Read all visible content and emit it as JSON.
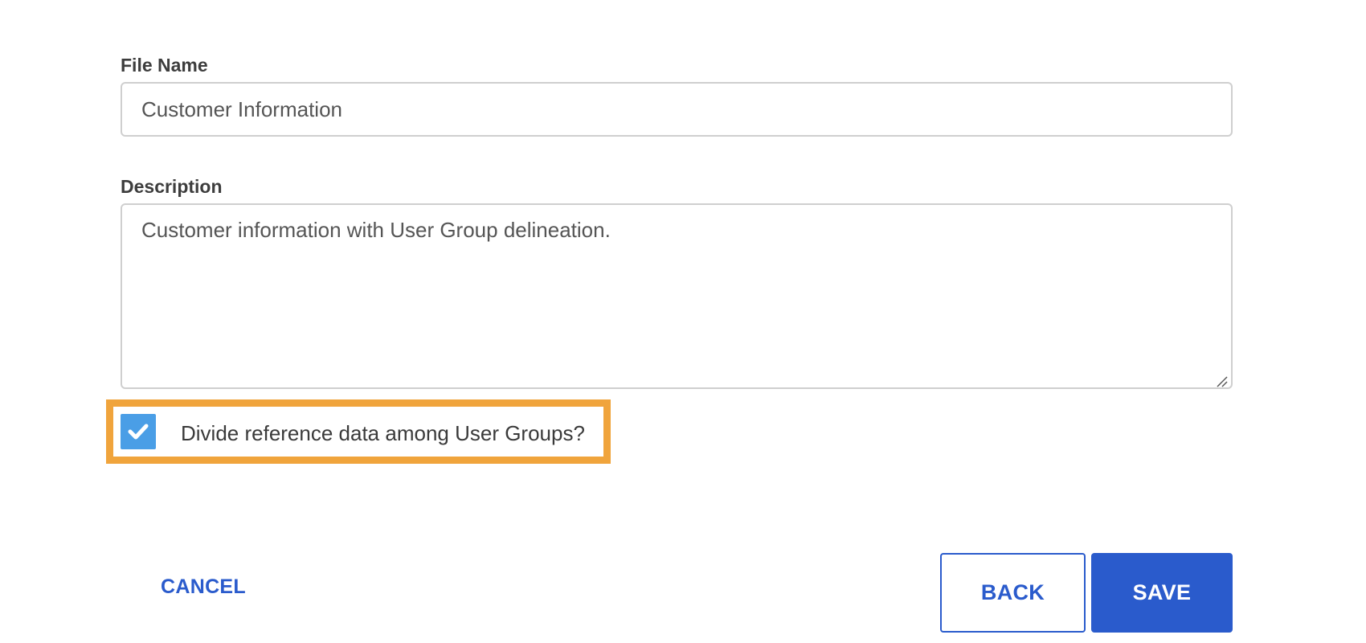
{
  "form": {
    "file_name": {
      "label": "File Name",
      "value": "Customer Information"
    },
    "description": {
      "label": "Description",
      "value": "Customer information with User Group delineation."
    },
    "divide_checkbox": {
      "label": "Divide reference data among User Groups?",
      "checked": true
    }
  },
  "actions": {
    "cancel_label": "CANCEL",
    "back_label": "BACK",
    "save_label": "SAVE"
  },
  "colors": {
    "primary": "#2a5bcc",
    "checkbox": "#4a9ee6",
    "highlight": "#f0a43c",
    "input_border": "#cfcfcf"
  },
  "icons": {
    "checkbox": "check-icon",
    "textarea_resize": "resize-handle-icon"
  }
}
